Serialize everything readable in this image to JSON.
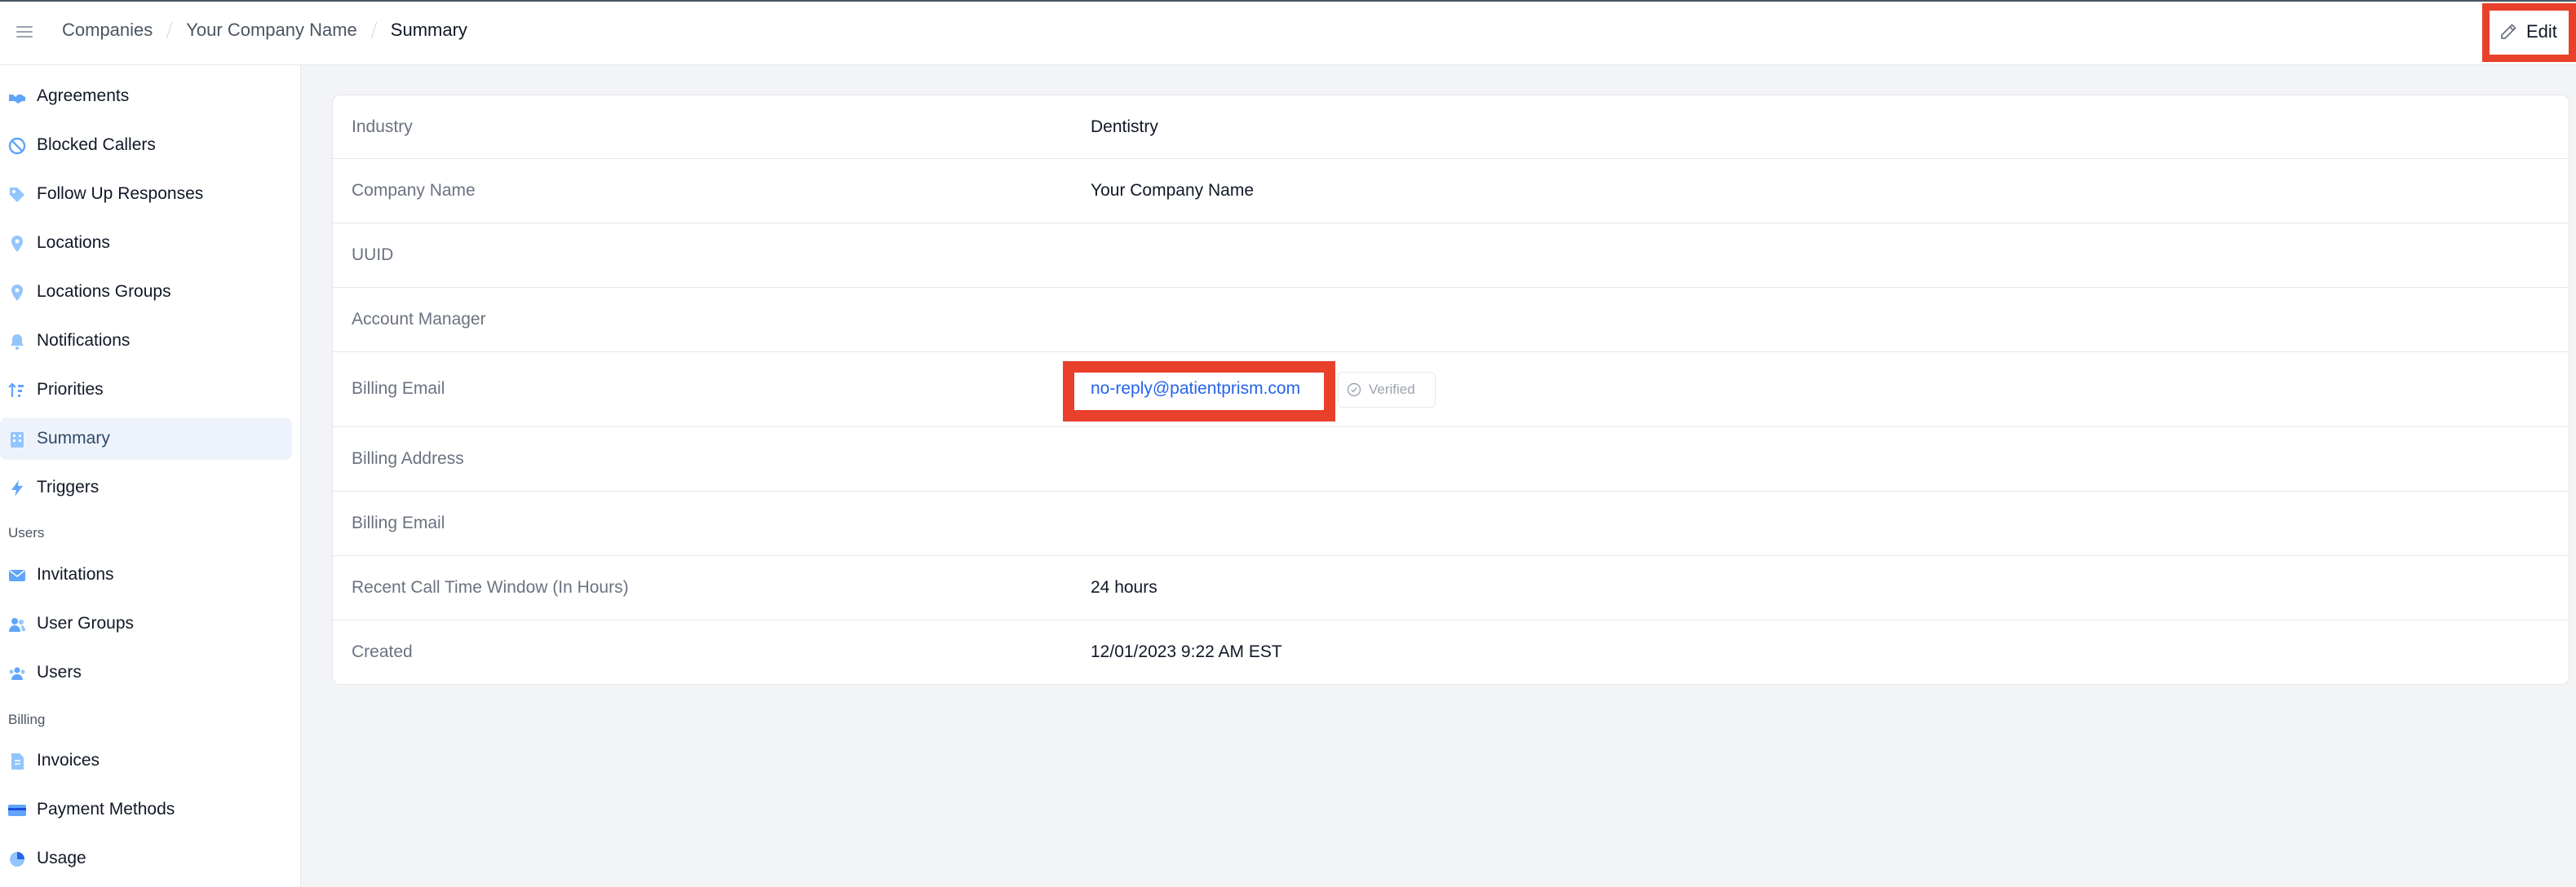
{
  "header": {
    "breadcrumbs": [
      "Companies",
      "Your Company Name",
      "Summary"
    ],
    "edit_label": "Edit"
  },
  "sidebar": {
    "items": [
      {
        "label": "Agreements",
        "icon": "handshake-icon"
      },
      {
        "label": "Blocked Callers",
        "icon": "blocked-icon"
      },
      {
        "label": "Follow Up Responses",
        "icon": "tag-icon"
      },
      {
        "label": "Locations",
        "icon": "location-pin-icon"
      },
      {
        "label": "Locations Groups",
        "icon": "location-pin-icon"
      },
      {
        "label": "Notifications",
        "icon": "bell-icon"
      },
      {
        "label": "Priorities",
        "icon": "sort-icon"
      },
      {
        "label": "Summary",
        "icon": "building-icon",
        "active": true
      },
      {
        "label": "Triggers",
        "icon": "bolt-icon"
      }
    ],
    "sections": [
      {
        "title": "Users",
        "items": [
          {
            "label": "Invitations",
            "icon": "envelope-icon"
          },
          {
            "label": "User Groups",
            "icon": "user-group-icon"
          },
          {
            "label": "Users",
            "icon": "users-icon"
          }
        ]
      },
      {
        "title": "Billing",
        "items": [
          {
            "label": "Invoices",
            "icon": "document-icon"
          },
          {
            "label": "Payment Methods",
            "icon": "credit-card-icon"
          },
          {
            "label": "Usage",
            "icon": "pie-chart-icon"
          }
        ]
      }
    ]
  },
  "summary": {
    "rows": [
      {
        "key": "Industry",
        "value": "Dentistry"
      },
      {
        "key": "Company Name",
        "value": "Your Company Name"
      },
      {
        "key": "UUID",
        "value": ""
      },
      {
        "key": "Account Manager",
        "value": ""
      },
      {
        "key": "Billing Email",
        "value": "no-reply@patientprism.com",
        "badge": "Verified"
      },
      {
        "key": "Billing Address",
        "value": ""
      },
      {
        "key": "Billing Email",
        "value": ""
      },
      {
        "key": "Recent Call Time Window (In Hours)",
        "value": "24 hours"
      },
      {
        "key": "Created",
        "value": "12/01/2023 9:22 AM EST"
      }
    ]
  },
  "colors": {
    "highlight": "#e8402a",
    "link": "#2563eb",
    "active_bg": "#eef3fb",
    "icon_blue": "#60a5fa"
  }
}
